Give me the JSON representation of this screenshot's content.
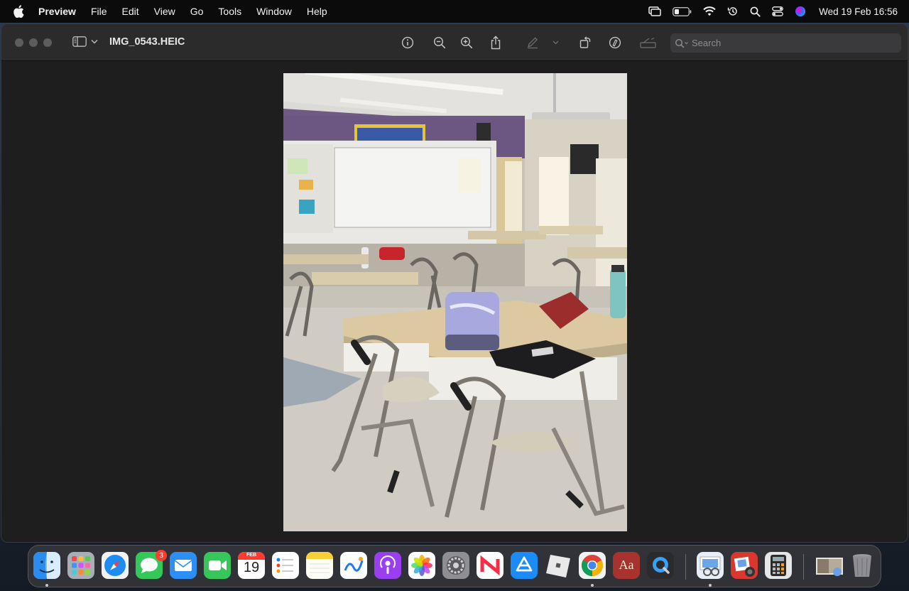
{
  "menubar": {
    "app_name": "Preview",
    "items": [
      "File",
      "Edit",
      "View",
      "Go",
      "Tools",
      "Window",
      "Help"
    ],
    "clock": "Wed 19 Feb  16:56",
    "status_icons": [
      "screen-mirroring-icon",
      "battery-icon",
      "wifi-icon",
      "time-machine-icon",
      "spotlight-icon",
      "control-center-icon",
      "siri-icon"
    ]
  },
  "window": {
    "title": "IMG_0543.HEIC",
    "search": {
      "placeholder": "Search",
      "value": ""
    },
    "toolbar_icons": [
      "info-icon",
      "zoom-out-icon",
      "zoom-in-icon",
      "share-icon",
      "markup-pen-icon",
      "markup-menu-chevron-icon",
      "rotate-icon",
      "annotate-icon",
      "sign-icon"
    ]
  },
  "dock": {
    "apps": [
      "Finder",
      "Launchpad",
      "Safari",
      "Messages",
      "Mail",
      "FaceTime",
      "Calendar",
      "Reminders",
      "Notes",
      "Freeform",
      "Podcasts",
      "Photos",
      "System Settings",
      "News",
      "App Store",
      "Roblox",
      "Google Chrome",
      "Dictionary",
      "QuickTime Player",
      "Preview",
      "Photo Booth",
      "Calculator",
      "Downloads",
      "Trash"
    ],
    "messages_badge": "3",
    "calendar_month": "FEB",
    "calendar_day": "19",
    "dictionary_label": "Aa"
  },
  "colors": {
    "menubar_bg": "#0b0b0c",
    "toolbar_bg": "#2b2b2c",
    "window_bg": "#1e1e1e",
    "badge": "#ff3b30"
  }
}
